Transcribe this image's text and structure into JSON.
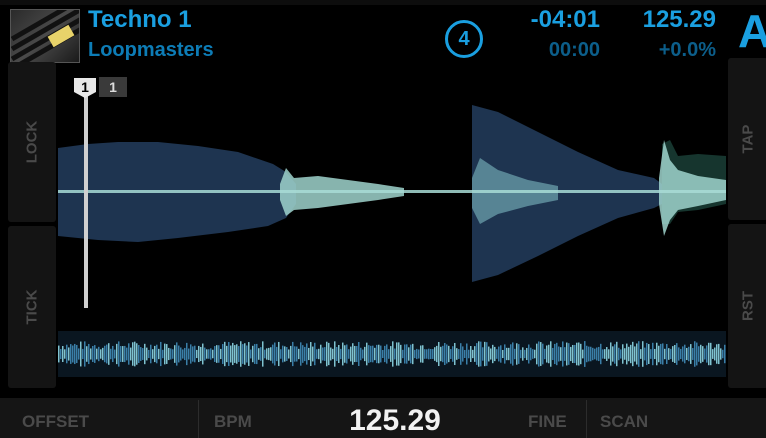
{
  "deck": {
    "title": "Techno 1",
    "artist": "Loopmasters",
    "loop_size": "4",
    "time_remaining": "-04:01",
    "time_elapsed": "00:00",
    "bpm": "125.29",
    "pitch": "+0.0%",
    "letter": "A"
  },
  "side_buttons": {
    "lock": "LOCK",
    "tick": "TICK",
    "tap": "TAP",
    "rst": "RST"
  },
  "cue": {
    "flag_number": "1",
    "label": "1"
  },
  "bottom": {
    "offset_label": "OFFSET",
    "bpm_label": "BPM",
    "bpm_value": "125.29",
    "fine_label": "FINE",
    "scan_label": "SCAN"
  },
  "colors": {
    "accent": "#1a9fe0",
    "accent_dim": "#0c5e8a",
    "waveform_dark": "#1e3450",
    "waveform_light": "#9fd4cc"
  }
}
